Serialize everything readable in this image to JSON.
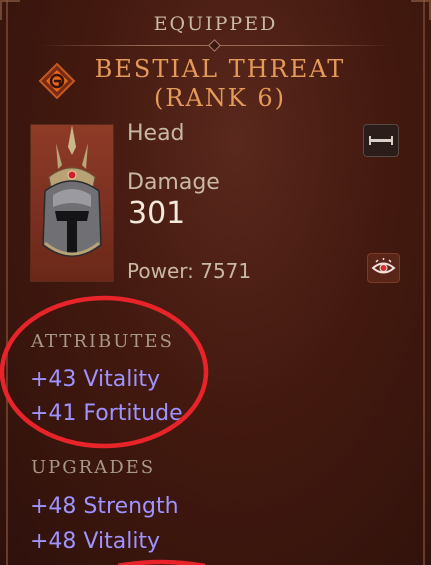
{
  "header": {
    "status_label": "EQUIPPED"
  },
  "item": {
    "title_line1": "BESTIAL THREAT",
    "title_line2": "(RANK 6)",
    "slot": "Head",
    "damage_label": "Damage",
    "damage_value": "301",
    "power_text": "Power: 7571",
    "rank_icon": "rank-emblem-icon",
    "portrait_icon": "helmet-icon"
  },
  "attributes": {
    "heading": "ATTRIBUTES",
    "lines": [
      "+43 Vitality",
      "+41 Fortitude"
    ]
  },
  "upgrades": {
    "heading": "UPGRADES",
    "lines": [
      "+48 Strength",
      "+48 Vitality"
    ]
  },
  "buttons": {
    "compare_icon": "compare-icon",
    "inspect_icon": "eye-icon"
  },
  "colors": {
    "title": "#e59a5a",
    "stat_blue": "#9f93ff",
    "annotation_red": "#e8242a"
  }
}
